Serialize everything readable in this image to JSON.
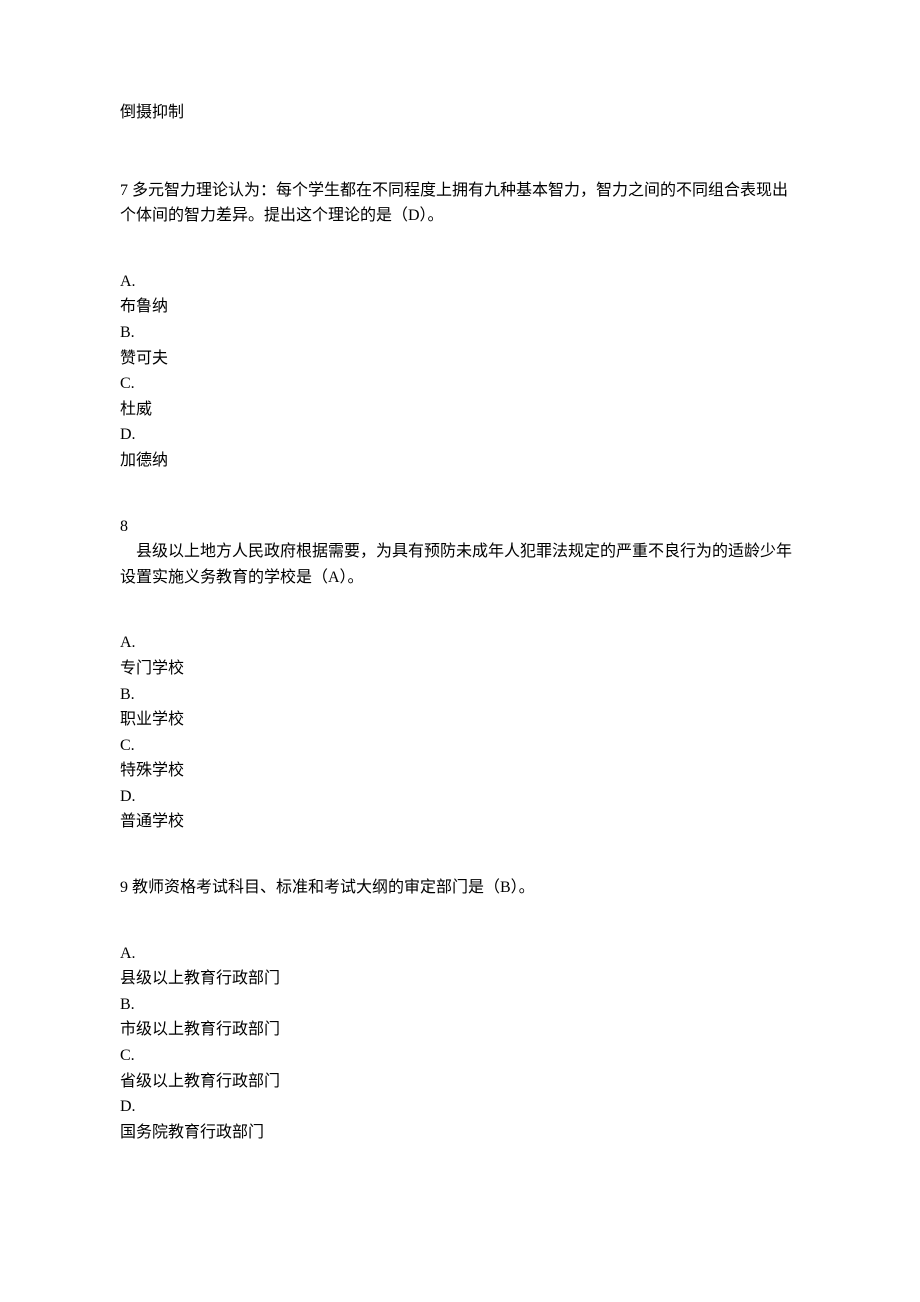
{
  "fragment": "倒摄抑制",
  "q7": {
    "text": "7 多元智力理论认为：每个学生都在不同程度上拥有九种基本智力，智力之间的不同组合表现出个体间的智力差异。提出这个理论的是（D）。",
    "options": {
      "a_letter": "A.",
      "a_text": "布鲁纳",
      "b_letter": "B.",
      "b_text": "赞可夫",
      "c_letter": "C.",
      "c_text": "杜威",
      "d_letter": "D.",
      "d_text": "加德纳"
    }
  },
  "q8": {
    "num": "8",
    "text": "　县级以上地方人民政府根据需要，为具有预防未成年人犯罪法规定的严重不良行为的适龄少年设置实施义务教育的学校是（A）。",
    "options": {
      "a_letter": "A.",
      "a_text": "专门学校",
      "b_letter": "B.",
      "b_text": "职业学校",
      "c_letter": "C.",
      "c_text": "特殊学校",
      "d_letter": "D.",
      "d_text": "普通学校"
    }
  },
  "q9": {
    "text": "9 教师资格考试科目、标准和考试大纲的审定部门是（B）。",
    "options": {
      "a_letter": "A.",
      "a_text": "县级以上教育行政部门",
      "b_letter": "B.",
      "b_text": "市级以上教育行政部门",
      "c_letter": "C.",
      "c_text": "省级以上教育行政部门",
      "d_letter": "D.",
      "d_text": "国务院教育行政部门"
    }
  }
}
